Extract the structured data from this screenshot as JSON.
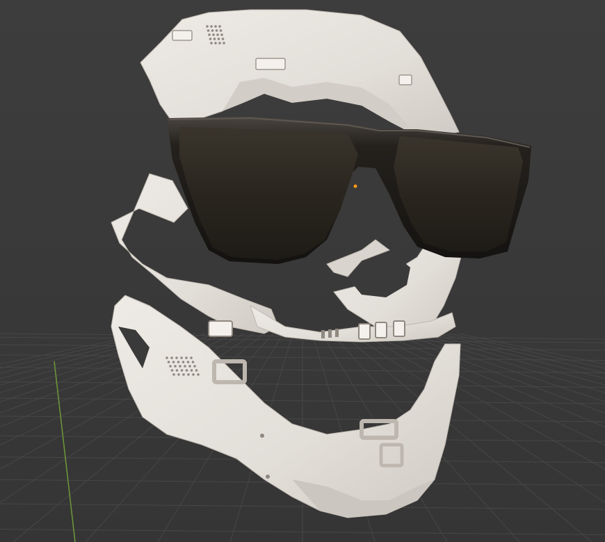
{
  "viewport": {
    "background": "#3a3a3a",
    "grid_color": "#474747",
    "y_axis_color": "#6e9a3a"
  },
  "scene": {
    "objects": [
      {
        "name": "skull-model",
        "color": "#e6e2dd"
      },
      {
        "name": "sunglasses",
        "color": "#1c1a17"
      }
    ],
    "origin_marker_color": "#ff9a1a"
  }
}
